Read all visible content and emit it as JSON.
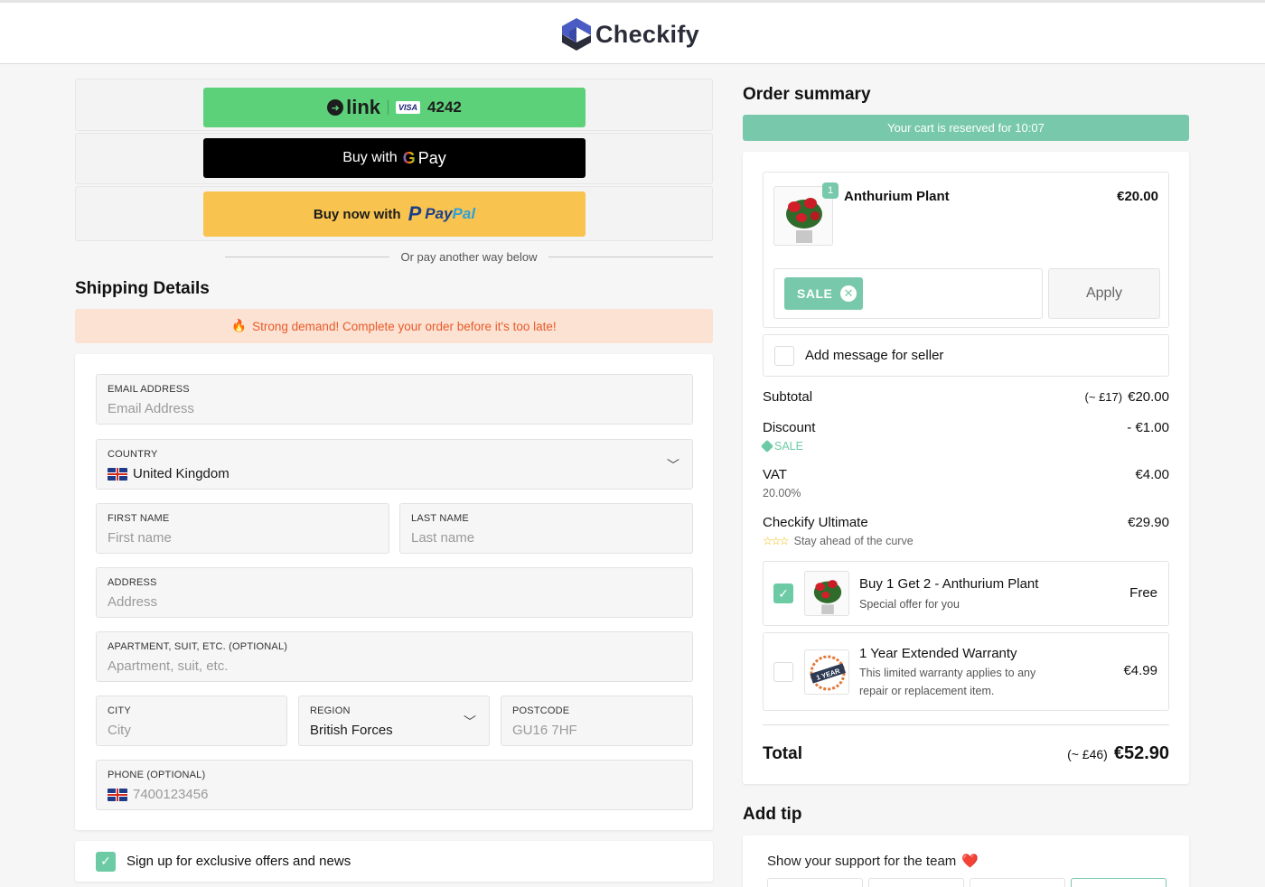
{
  "header": {
    "brand": "Checkify"
  },
  "express": {
    "link_text": "link",
    "visa": "VISA",
    "card_last4": "4242",
    "gpay_prefix": "Buy with",
    "gpay_text": "Pay",
    "paypal_prefix": "Buy now with",
    "paypal_brand_a": "Pay",
    "paypal_brand_b": "Pal",
    "or_text": "Or pay another way below"
  },
  "shipping": {
    "title": "Shipping Details",
    "demand": "Strong demand! Complete your order before it's too late!",
    "fields": {
      "email_label": "EMAIL ADDRESS",
      "email_placeholder": "Email Address",
      "country_label": "COUNTRY",
      "country_value": "United Kingdom",
      "first_label": "FIRST NAME",
      "first_placeholder": "First name",
      "last_label": "LAST NAME",
      "last_placeholder": "Last name",
      "address_label": "ADDRESS",
      "address_placeholder": "Address",
      "apt_label": "APARTMENT, SUIT, ETC. (OPTIONAL)",
      "apt_placeholder": "Apartment, suit, etc.",
      "city_label": "CITY",
      "city_placeholder": "City",
      "region_label": "REGION",
      "region_value": "British Forces",
      "postcode_label": "POSTCODE",
      "postcode_placeholder": "GU16 7HF",
      "phone_label": "PHONE (OPTIONAL)",
      "phone_placeholder": "7400123456"
    },
    "signup": "Sign up for exclusive offers and news"
  },
  "summary": {
    "title": "Order summary",
    "reserved": "Your cart is reserved for 10:07",
    "product": {
      "name": "Anthurium Plant",
      "qty": "1",
      "price": "€20.00"
    },
    "coupon": {
      "code": "SALE",
      "apply": "Apply"
    },
    "message": "Add message for seller",
    "subtotal": {
      "label": "Subtotal",
      "approx": "(~ £17)",
      "value": "€20.00"
    },
    "discount": {
      "label": "Discount",
      "code": "SALE",
      "value": "- €1.00"
    },
    "vat": {
      "label": "VAT",
      "rate": "20.00%",
      "value": "€4.00"
    },
    "ultimate": {
      "label": "Checkify Ultimate",
      "stars": "☆☆☆",
      "tagline": "Stay ahead of the curve",
      "value": "€29.90"
    },
    "upsell1": {
      "title": "Buy 1 Get 2 - Anthurium Plant",
      "sub": "Special offer for you",
      "price": "Free",
      "checked": true
    },
    "upsell2": {
      "title": "1 Year Extended Warranty",
      "sub1": "This limited warranty applies to any",
      "sub2": "repair or replacement item.",
      "price": "€4.99",
      "checked": false,
      "badge": "1 YEAR"
    },
    "total": {
      "label": "Total",
      "approx": "(~ £46)",
      "value": "€52.90"
    }
  },
  "tip": {
    "title": "Add tip",
    "text": "Show your support for the team"
  }
}
